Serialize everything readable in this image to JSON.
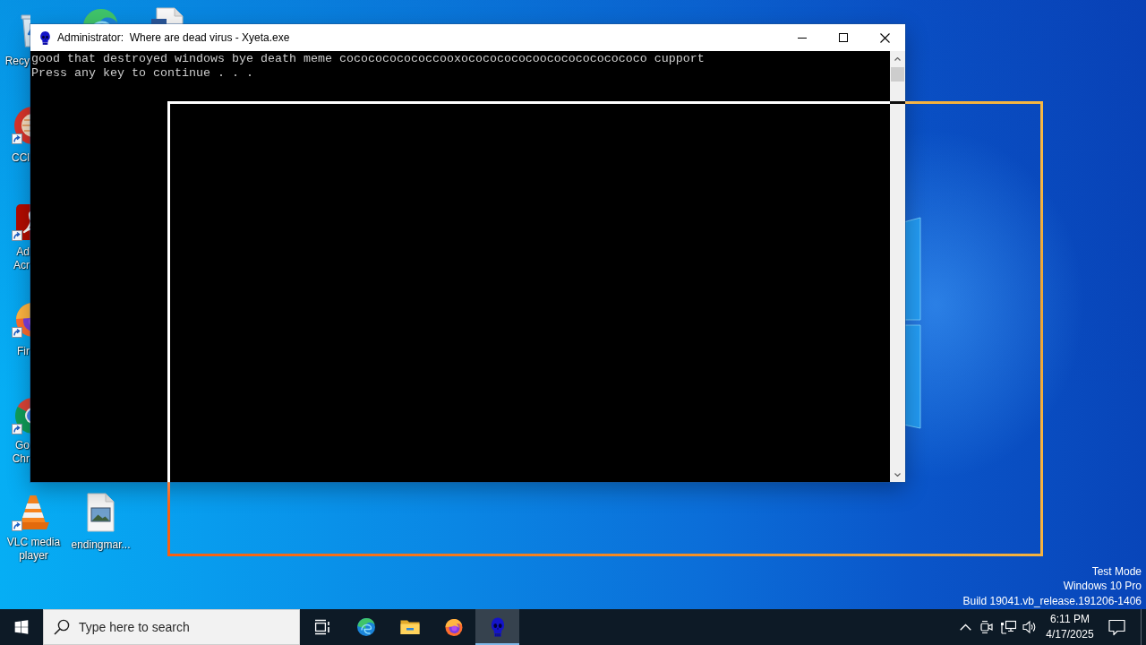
{
  "window": {
    "title": "Administrator:  Where are dead virus - Xyeta.exe",
    "console_lines": [
      "good that destroyed windows bye death meme cococococococcooxocococococoocococococococo cupport",
      "Press any key to continue . . ."
    ]
  },
  "desktop": {
    "icons": [
      {
        "label": "Recy",
        "kind": "bin",
        "shortcut": false
      },
      {
        "label": "CCl",
        "kind": "cleaner",
        "shortcut": true
      },
      {
        "label": "Ad Acr",
        "kind": "pdf",
        "shortcut": true
      },
      {
        "label": "Fir",
        "kind": "fox",
        "shortcut": true
      },
      {
        "label": "Go Chr",
        "kind": "chrome",
        "shortcut": true
      },
      {
        "label": "VLC media player",
        "kind": "cone",
        "shortcut": true
      },
      {
        "label": "endingmar...",
        "kind": "image",
        "shortcut": false
      }
    ],
    "system_info": [
      "Test Mode",
      "Windows 10 Pro",
      "Build 19041.vb_release.191206-1406"
    ]
  },
  "taskbar": {
    "search": {
      "placeholder": "Type here to search"
    },
    "apps": [
      {
        "kind": "edge",
        "selected": false
      },
      {
        "kind": "folder",
        "selected": false
      },
      {
        "kind": "fox",
        "selected": false
      },
      {
        "kind": "skull",
        "selected": true
      }
    ],
    "clock": {
      "time": "6:11 PM",
      "date": "4/17/2025"
    }
  }
}
